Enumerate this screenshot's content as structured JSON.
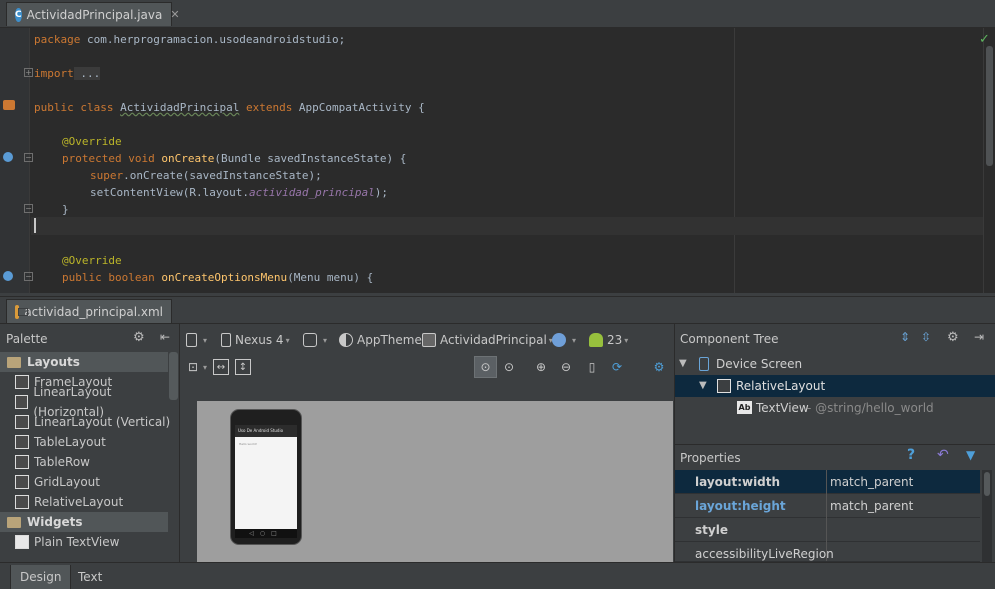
{
  "editor_tab": {
    "label": "ActividadPrincipal.java",
    "icon": "class-c-icon"
  },
  "code": {
    "line1": {
      "kw": "package",
      "rest": " com.herprogramacion.usodeandroidstudio;"
    },
    "line2": {
      "kw": "import",
      "rest": " ..."
    },
    "line3": {
      "kw1": "public class",
      "name": "ActividadPrincipal",
      "kw2": "extends",
      "rest": " AppCompatActivity {"
    },
    "line4": {
      "annotation": "@Override"
    },
    "line5": {
      "kw": "protected void",
      "fn": "onCreate",
      "rest": "(Bundle savedInstanceState) {"
    },
    "line6": {
      "kw": "super",
      "rest": ".onCreate(savedInstanceState);"
    },
    "line7": {
      "pre": "setContentView(R.layout.",
      "italic": "actividad_principal",
      "post": ");"
    },
    "line8": {
      "text": "}"
    },
    "line9": {
      "annotation": "@Override"
    },
    "line10": {
      "kw": "public boolean",
      "fn": "onCreateOptionsMenu",
      "rest": "(Menu menu) {"
    }
  },
  "xml_tab": {
    "label": "actividad_principal.xml"
  },
  "palette": {
    "title": "Palette",
    "categories": [
      {
        "label": "Layouts",
        "items": [
          "FrameLayout",
          "LinearLayout (Horizontal)",
          "LinearLayout (Vertical)",
          "TableLayout",
          "TableRow",
          "GridLayout",
          "RelativeLayout"
        ]
      },
      {
        "label": "Widgets",
        "items": [
          "Plain TextView"
        ]
      }
    ]
  },
  "toolbar": {
    "device": "Nexus 4",
    "theme": "AppTheme",
    "activity": "ActividadPrincipal",
    "api": "23"
  },
  "preview": {
    "app_title": "Uso De Android Studio",
    "hello_text": "Hello world!"
  },
  "component_tree": {
    "title": "Component Tree",
    "nodes": [
      {
        "label": "Device Screen"
      },
      {
        "label": "RelativeLayout"
      },
      {
        "label": "TextView",
        "suffix": "- @string/hello_world"
      }
    ]
  },
  "properties": {
    "title": "Properties",
    "rows": [
      {
        "name": "layout:width",
        "value": "match_parent"
      },
      {
        "name": "layout:height",
        "value": "match_parent"
      },
      {
        "name": "style",
        "value": ""
      },
      {
        "name": "accessibilityLiveRegion",
        "value": ""
      }
    ]
  },
  "bottom_tabs": {
    "design": "Design",
    "text": "Text"
  },
  "colors": {
    "accent": "#0d293e",
    "keyword": "#cc7832",
    "annotation": "#bbb529",
    "function": "#ffc66d",
    "editor_bg": "#2b2b2b"
  }
}
